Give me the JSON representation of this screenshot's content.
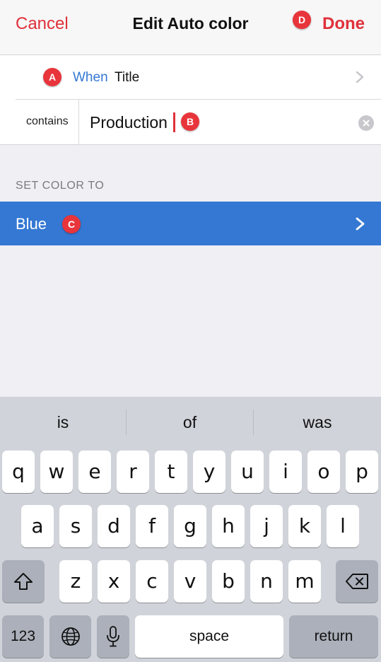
{
  "nav": {
    "cancel_label": "Cancel",
    "title": "Edit Auto color",
    "done_label": "Done"
  },
  "form": {
    "when_label": "When",
    "when_value": "Title",
    "contains_label": "contains",
    "contains_value": "Production"
  },
  "section": {
    "header": "SET COLOR TO"
  },
  "color": {
    "label": "Blue",
    "hex": "#3478d4"
  },
  "annotations": {
    "a": "A",
    "b": "B",
    "c": "C",
    "d": "D"
  },
  "keyboard": {
    "suggestions": [
      "is",
      "of",
      "was"
    ],
    "row1": [
      "q",
      "w",
      "e",
      "r",
      "t",
      "y",
      "u",
      "i",
      "o",
      "p"
    ],
    "row2": [
      "a",
      "s",
      "d",
      "f",
      "g",
      "h",
      "j",
      "k",
      "l"
    ],
    "row3": [
      "z",
      "x",
      "c",
      "v",
      "b",
      "n",
      "m"
    ],
    "numbers_label": "123",
    "space_label": "space",
    "return_label": "return",
    "icons": [
      "shift-icon",
      "backspace-icon",
      "globe-icon",
      "microphone-icon"
    ]
  },
  "colors": {
    "accent_red": "#e0303a",
    "link_blue": "#3478d4",
    "badge_red": "#e8353b"
  }
}
